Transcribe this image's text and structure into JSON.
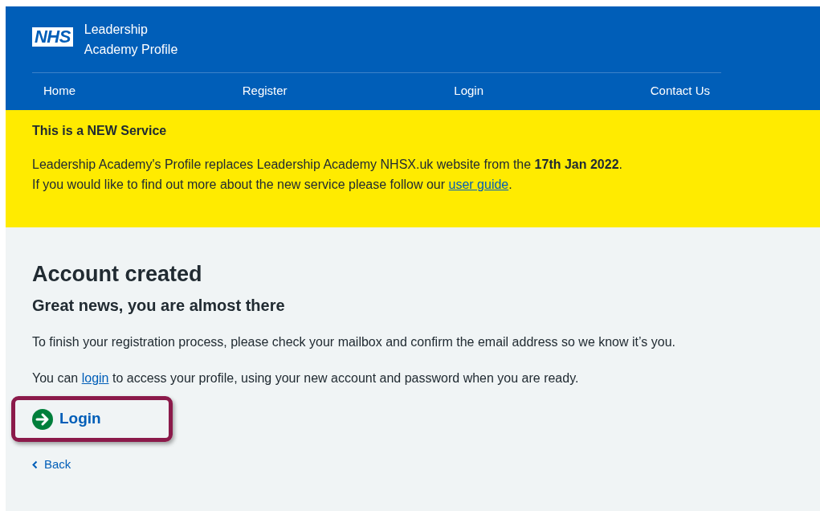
{
  "header": {
    "logo": "NHS",
    "title_lines": [
      "Leadership",
      "Academy Profile"
    ]
  },
  "nav": [
    {
      "label": "Home"
    },
    {
      "label": "Register"
    },
    {
      "label": "Login"
    },
    {
      "label": "Contact Us"
    }
  ],
  "banner": {
    "heading": "This is a NEW Service",
    "line_1": "Leadership Academy's Profile replaces Leadership Academy NHSX.uk website from the **17th Jan 2022**.",
    "line_2": {
      "before": "If you would like to find out more about the new service please follow our ",
      "link": "user guide",
      "after": "."
    }
  },
  "main": {
    "title": "Account created",
    "subtitle": "Great news, you are almost there",
    "paragraph_1": "To finish your registration process, please check your mailbox and confirm the email address so we know it’s you.",
    "paragraph_2": {
      "before": "You can ",
      "link": "login",
      "after": " to access your profile, using your new account and password when you are ready."
    },
    "action_link": "Login",
    "back_link": "Back"
  }
}
